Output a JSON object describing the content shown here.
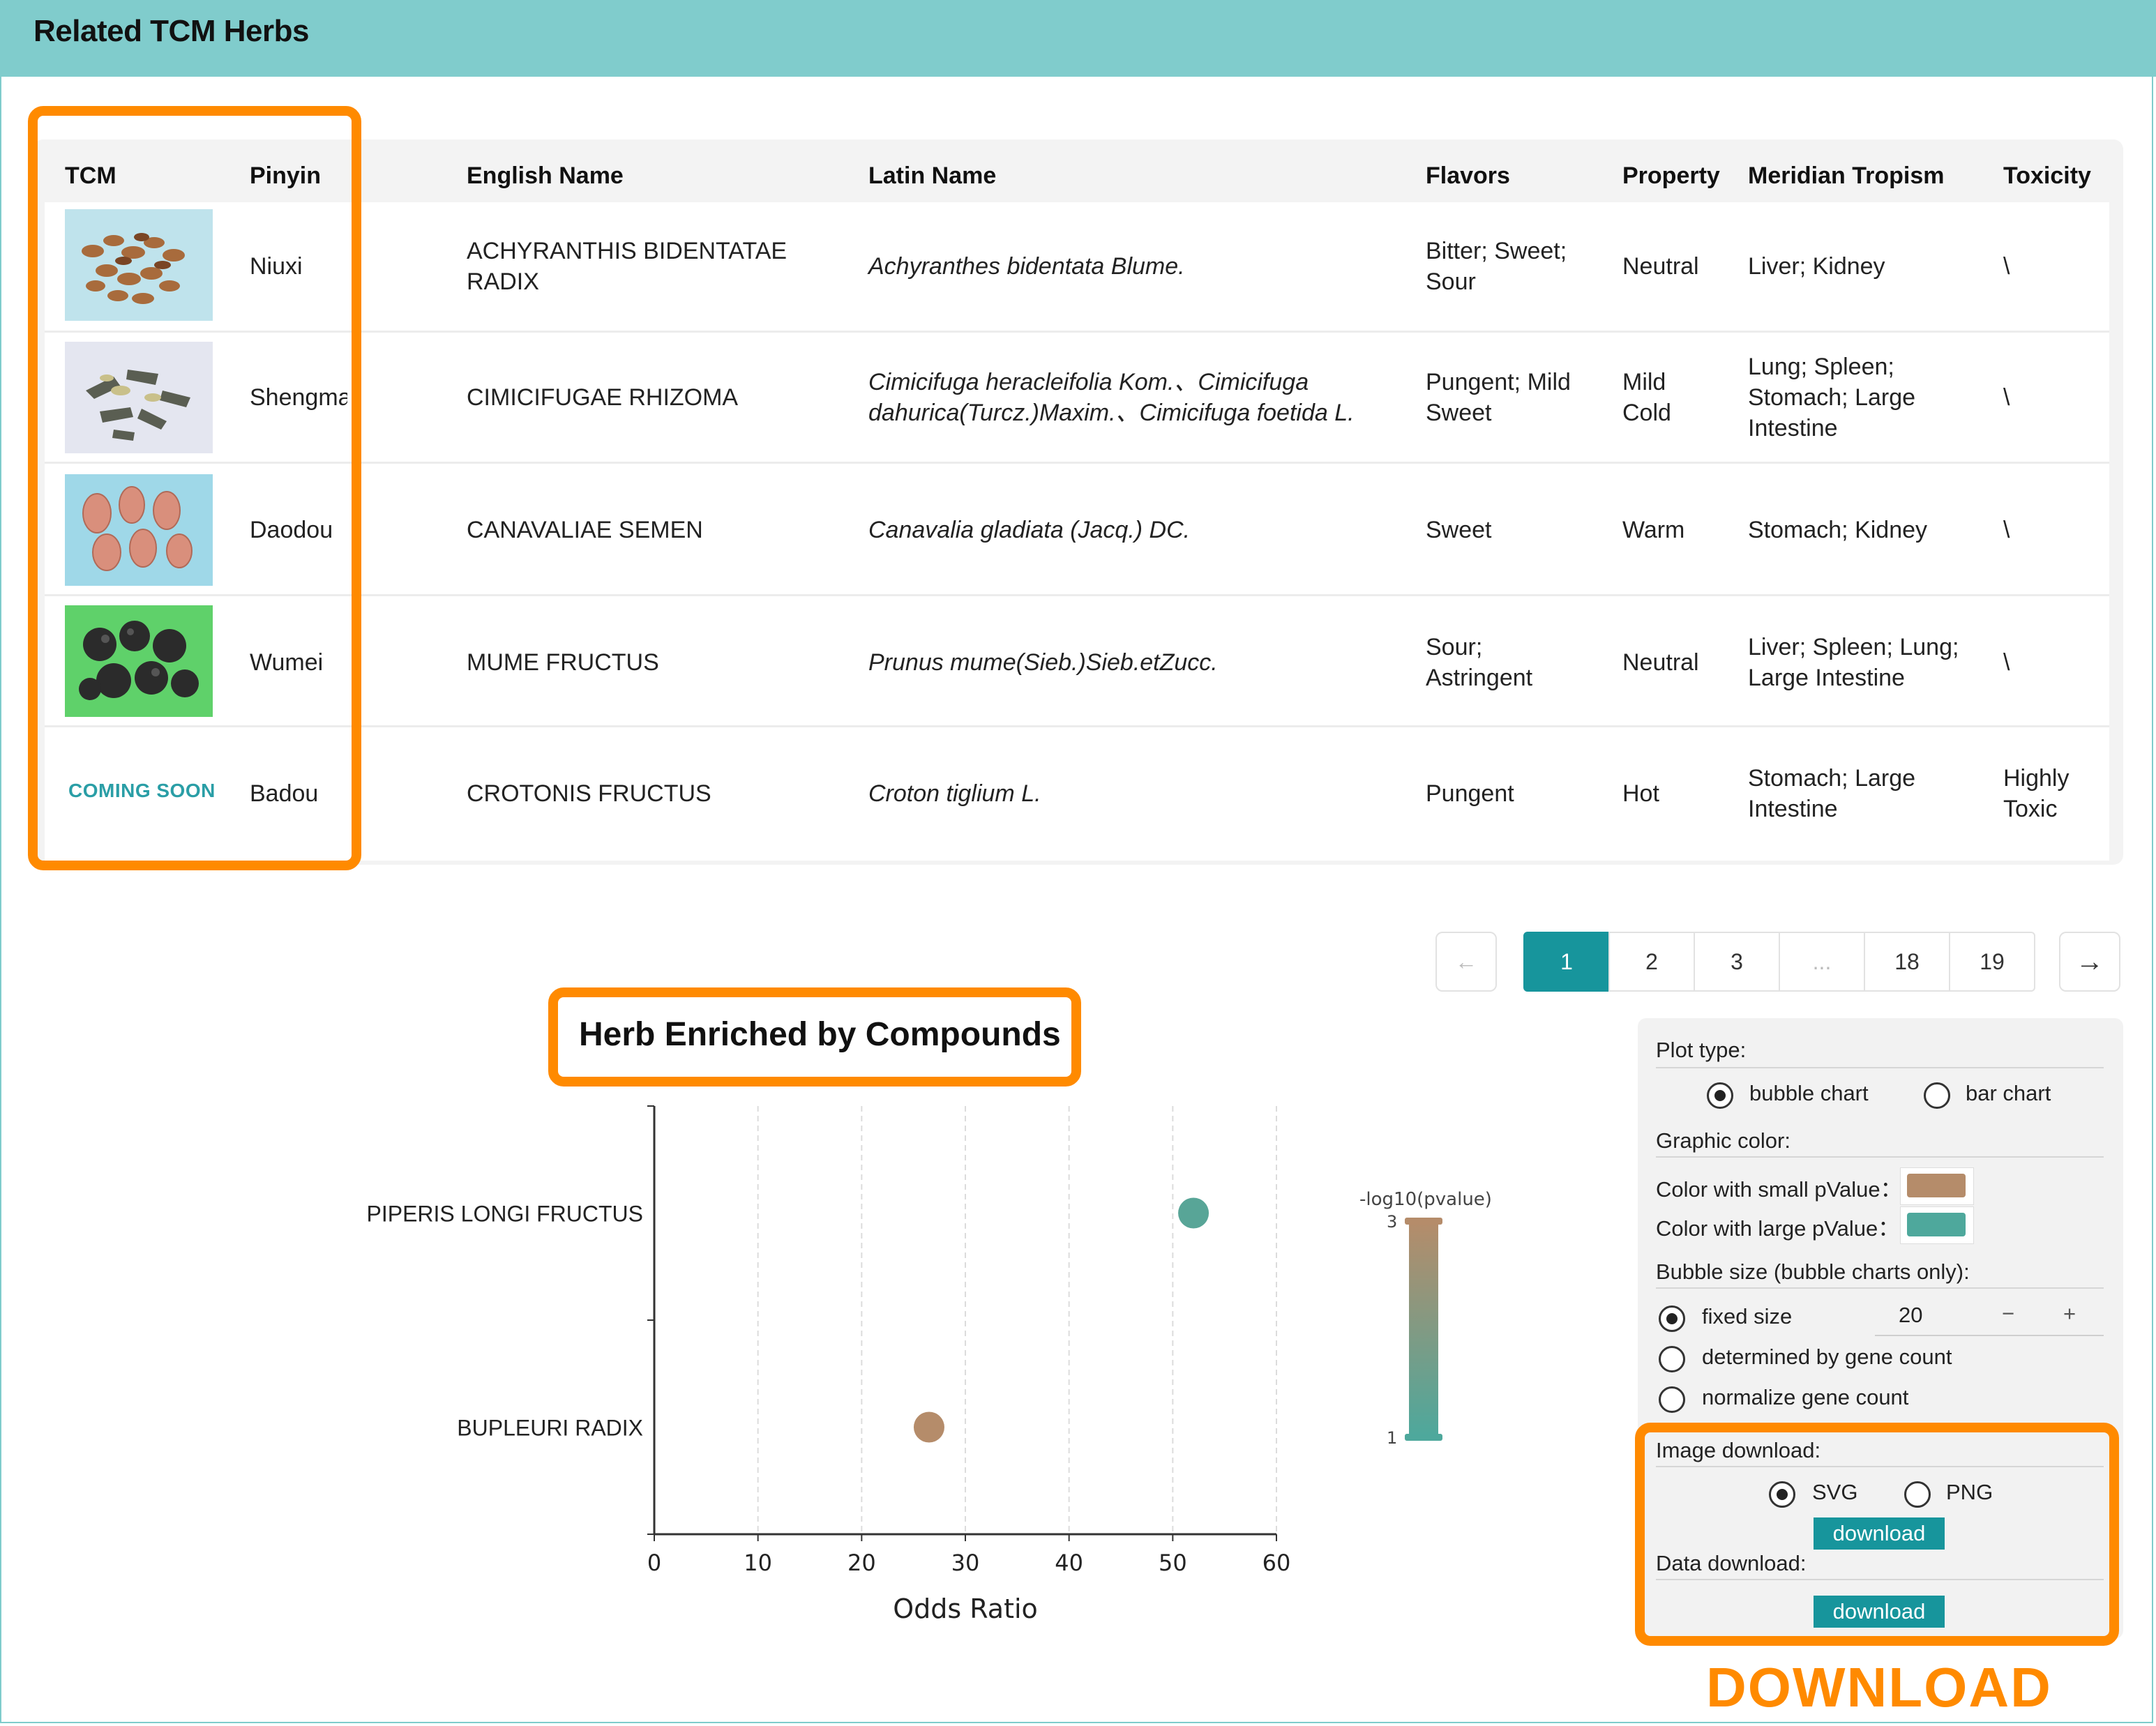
{
  "header": {
    "title": "Related TCM Herbs"
  },
  "table": {
    "columns": [
      "TCM",
      "Pinyin",
      "English Name",
      "Latin Name",
      "Flavors",
      "Property",
      "Meridian Tropism",
      "Toxicity"
    ],
    "rows": [
      {
        "image": "herb-photo-niuxi",
        "pinyin": "Niuxi",
        "english": "ACHYRANTHIS BIDENTATAE RADIX",
        "latin": "Achyranthes bidentata Blume.",
        "flavors": "Bitter; Sweet; Sour",
        "property": "Neutral",
        "meridian": "Liver; Kidney",
        "toxicity": "\\"
      },
      {
        "image": "herb-photo-shengma",
        "pinyin": "Shengma",
        "english": "CIMICIFUGAE RHIZOMA",
        "latin": "Cimicifuga heracleifolia Kom.、Cimicifuga dahurica(Turcz.)Maxim.、Cimicifuga foetida L.",
        "flavors": "Pungent; Mild Sweet",
        "property": "Mild Cold",
        "meridian": "Lung; Spleen; Stomach; Large Intestine",
        "toxicity": "\\"
      },
      {
        "image": "herb-photo-daodou",
        "pinyin": "Daodou",
        "english": "CANAVALIAE SEMEN",
        "latin": "Canavalia gladiata (Jacq.) DC.",
        "flavors": "Sweet",
        "property": "Warm",
        "meridian": "Stomach; Kidney",
        "toxicity": "\\"
      },
      {
        "image": "herb-photo-wumei",
        "pinyin": "Wumei",
        "english": "MUME FRUCTUS",
        "latin": "Prunus mume(Sieb.)Sieb.etZucc.",
        "flavors": "Sour; Astringent",
        "property": "Neutral",
        "meridian": "Liver; Spleen; Lung; Large Intestine",
        "toxicity": "\\"
      },
      {
        "image": "coming-soon",
        "coming_soon": "COMING SOON",
        "pinyin": "Badou",
        "english": "CROTONIS FRUCTUS",
        "latin": "Croton tiglium L.",
        "flavors": "Pungent",
        "property": "Hot",
        "meridian": "Stomach; Large Intestine",
        "toxicity": "Highly Toxic"
      }
    ]
  },
  "pagination": {
    "prev": "←",
    "pages": [
      "1",
      "2",
      "3",
      "...",
      "18",
      "19"
    ],
    "current": "1",
    "next": "→"
  },
  "chart_data": {
    "type": "scatter",
    "title": "Herb Enriched by Compounds",
    "xlabel": "Odds Ratio",
    "ylabel": "",
    "xlim": [
      0,
      60
    ],
    "xticks": [
      "0",
      "10",
      "20",
      "30",
      "40",
      "50",
      "60"
    ],
    "categories": [
      "PIPERIS LONGI FRUCTUS",
      "BUPLEURI RADIX"
    ],
    "points": [
      {
        "category": "PIPERIS LONGI FRUCTUS",
        "x": 52,
        "neglog10p": 1.2
      },
      {
        "category": "BUPLEURI RADIX",
        "x": 26.5,
        "neglog10p": 3
      }
    ],
    "colorbar": {
      "label": "-log10(pvalue)",
      "max_label": "3",
      "min_label": "1",
      "range": [
        1,
        3
      ]
    },
    "grid": "vertical dashed"
  },
  "panel": {
    "plot_type_label": "Plot type:",
    "plot_types": [
      "bubble chart",
      "bar chart"
    ],
    "plot_type_selected": "bubble chart",
    "graphic_color_label": "Graphic color:",
    "color_small_label": "Color with small pValue：",
    "color_large_label": "Color with large pValue：",
    "bubble_size_label": "Bubble size (bubble charts only):",
    "size_options": [
      "fixed size",
      "determined by gene count",
      "normalize gene count"
    ],
    "size_selected": "fixed size",
    "fixed_size_value": "20",
    "minus": "−",
    "plus": "+",
    "image_download_label": "Image download:",
    "image_formats": [
      "SVG",
      "PNG"
    ],
    "image_format_selected": "SVG",
    "download_btn": "download",
    "data_download_label": "Data download:"
  },
  "colors": {
    "accent": "#17959c",
    "header": "#80cccc",
    "highlight": "#ff8a00",
    "small_p": "#b58c6a",
    "large_p": "#4ea89c"
  },
  "annotation": {
    "download_caption": "DOWNLOAD"
  }
}
